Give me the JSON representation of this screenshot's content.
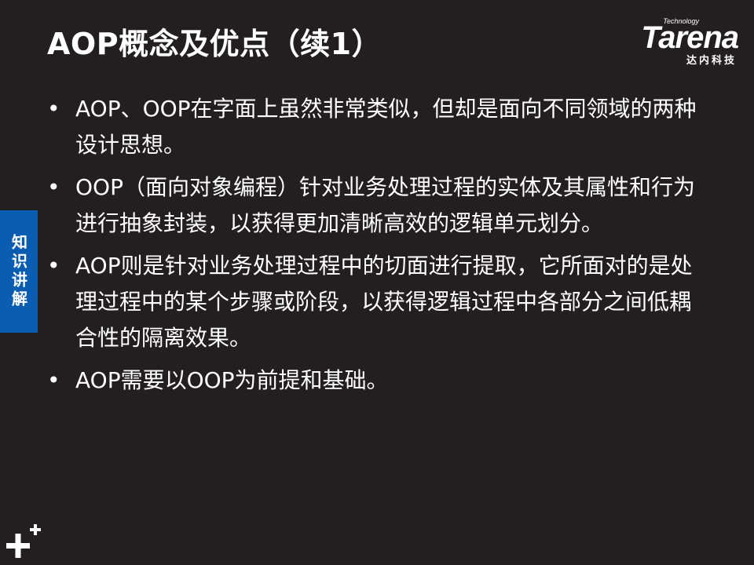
{
  "slide": {
    "title": "AOP概念及优点（续1）"
  },
  "logo": {
    "tagline": "Technology",
    "brand": "Tarena",
    "brand_cn": "达内科技"
  },
  "side_tab": {
    "label": "知识讲解"
  },
  "bullets": [
    {
      "marker": "•",
      "text": "AOP、OOP在字面上虽然非常类似，但却是面向不同领域的两种设计思想。"
    },
    {
      "marker": "•",
      "text": "OOP（面向对象编程）针对业务处理过程的实体及其属性和行为进行抽象封装，以获得更加清晰高效的逻辑单元划分。"
    },
    {
      "marker": "•",
      "text": "AOP则是针对业务处理过程中的切面进行提取，它所面对的是处理过程中的某个步骤或阶段，以获得逻辑过程中各部分之间低耦合性的隔离效果。"
    },
    {
      "marker": "•",
      "text": "AOP需要以OOP为前提和基础。"
    }
  ],
  "colors": {
    "background": "#231f20",
    "side_tab": "#0b5db1",
    "text": "#ffffff"
  },
  "icons": {
    "corner": "plus-icon"
  }
}
